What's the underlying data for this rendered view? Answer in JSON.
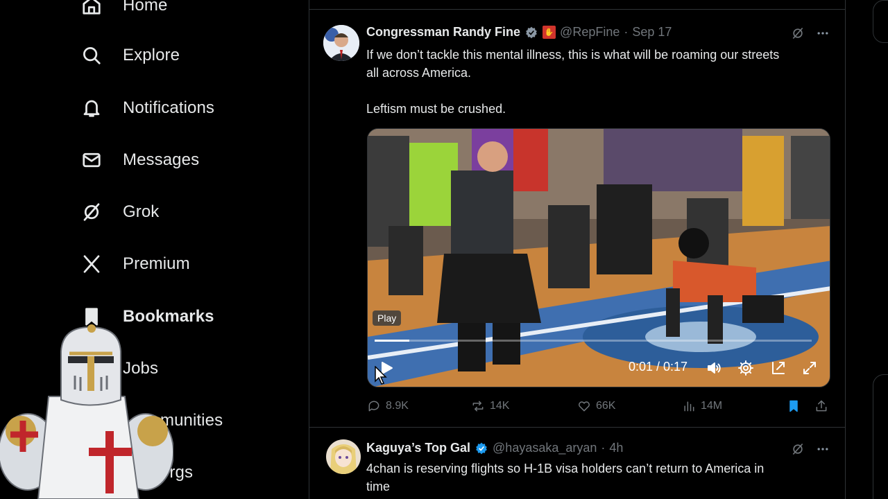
{
  "nav": {
    "items": [
      {
        "label": "Home",
        "icon": "home-icon"
      },
      {
        "label": "Explore",
        "icon": "search-icon"
      },
      {
        "label": "Notifications",
        "icon": "bell-icon"
      },
      {
        "label": "Messages",
        "icon": "envelope-icon"
      },
      {
        "label": "Grok",
        "icon": "grok-icon"
      },
      {
        "label": "Premium",
        "icon": "x-logo-icon"
      },
      {
        "label": "Bookmarks",
        "icon": "bookmark-icon"
      },
      {
        "label": "Jobs",
        "icon": "briefcase-icon"
      },
      {
        "label": "Communities",
        "visible_text": "munities",
        "icon": "communities-icon"
      },
      {
        "label": "Verified Orgs",
        "visible_text": "ed Orgs",
        "icon": "verified-orgs-icon"
      }
    ]
  },
  "posts": [
    {
      "author_name": "Congressman Randy Fine",
      "handle": "@RepFine",
      "separator": "·",
      "date": "Sep 17",
      "text_line1": "If we don’t tackle this mental illness, this is what will be roaming our streets",
      "text_line2": "all across America.",
      "text_line3": "Leftism must be crushed.",
      "video": {
        "tooltip": "Play",
        "timecode": "0:01 / 0:17",
        "progress": 0.08
      },
      "stats": {
        "replies": "8.9K",
        "reposts": "14K",
        "likes": "66K",
        "views": "14M"
      },
      "bookmarked": true
    },
    {
      "author_name": "Kaguya’s Top Gal",
      "handle": "@hayasaka_aryan",
      "separator": "·",
      "date": "4h",
      "text_line1": "4chan is reserving flights so H-1B visa holders can’t return to America in",
      "text_line2": "time"
    }
  ],
  "colors": {
    "background": "#000000",
    "text": "#e7e9ea",
    "muted": "#71767b",
    "accent": "#1d9bf0",
    "border": "#2f3336"
  }
}
